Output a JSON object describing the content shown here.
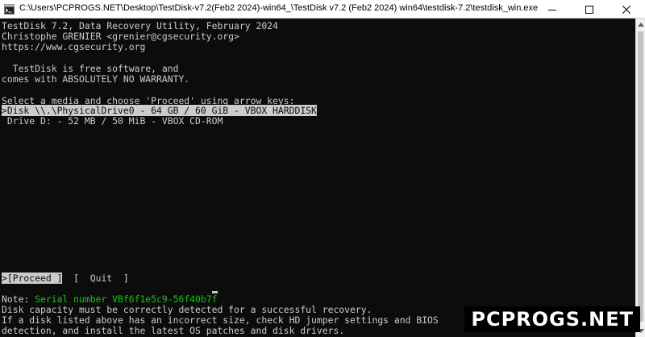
{
  "window": {
    "title": "C:\\Users\\PCPROGS.NET\\Desktop\\TestDisk-v7.2(Feb2 2024)-win64_\\TestDisk v7.2 (Feb2 2024) win64\\testdisk-7.2\\testdisk_win.exe",
    "icon": "console-app-icon",
    "controls": [
      "minimize-icon",
      "maximize-icon",
      "close-icon"
    ]
  },
  "console": {
    "header": [
      "TestDisk 7.2, Data Recovery Utility, February 2024",
      "Christophe GRENIER <grenier@cgsecurity.org>",
      "https://www.cgsecurity.org"
    ],
    "license": [
      "  TestDisk is free software, and",
      "comes with ABSOLUTELY NO WARRANTY."
    ],
    "prompt": "Select a media and choose 'Proceed' using arrow keys:",
    "media": [
      {
        "label": ">Disk \\\\.\\PhysicalDrive0 - 64 GB / 60 GiB - VBOX HARDDISK",
        "selected": true
      },
      {
        "label": " Drive D: - 52 MB / 50 MiB - VBOX CD-ROM",
        "selected": false
      }
    ],
    "menu": {
      "proceed": ">[Proceed ]",
      "quit": "[  Quit  ]"
    },
    "note_label": "Note: ",
    "serial": "Serial number VBf6f1e5c9-56f40b7f",
    "notes": [
      "Disk capacity must be correctly detected for a successful recovery.",
      "If a disk listed above has an incorrect size, check HD jumper settings and BIOS",
      "detection, and install the latest OS patches and disk drivers."
    ]
  },
  "watermark": "PCPROGS.NET",
  "colors": {
    "background": "#0c0c0c",
    "text": "#cccccc",
    "serial": "#16c60c"
  }
}
